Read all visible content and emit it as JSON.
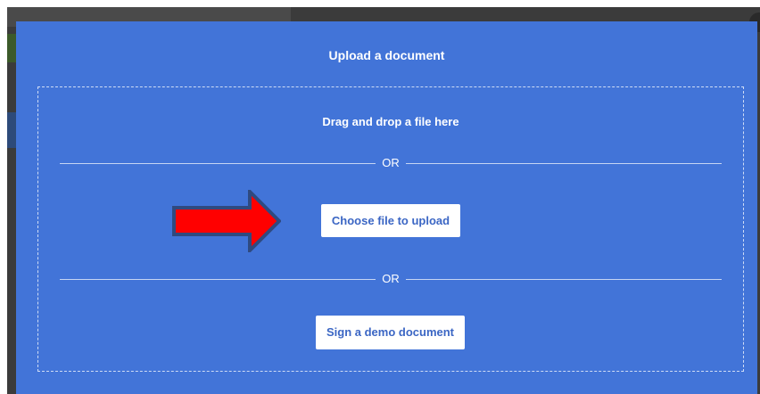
{
  "modal": {
    "title": "Upload a document",
    "drop_text": "Drag and drop a file here",
    "divider_top_text": "OR",
    "choose_file_label": "Choose file to upload",
    "divider_bottom_text": "OR",
    "demo_label": "Sign a demo document"
  },
  "annotation": {
    "icon": "red-arrow-icon",
    "fill_color": "#ff0000",
    "outline_color": "#2f4a80"
  },
  "colors": {
    "modal_background": "#4274d8",
    "button_background": "#ffffff",
    "button_text": "#3b66c4"
  }
}
